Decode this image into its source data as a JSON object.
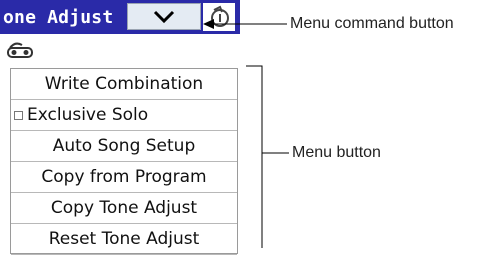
{
  "header": {
    "title": "one Adjust",
    "menu_command_icon": "chevron-down-icon",
    "edge_icon": "rotate-icon"
  },
  "sub_icon": "connector-icon",
  "menu": {
    "items": [
      {
        "label": "Write Combination",
        "checkbox": false
      },
      {
        "label": "Exclusive Solo",
        "checkbox": true
      },
      {
        "label": "Auto Song Setup",
        "checkbox": false
      },
      {
        "label": "Copy from Program",
        "checkbox": false
      },
      {
        "label": "Copy Tone Adjust",
        "checkbox": false
      },
      {
        "label": "Reset Tone Adjust",
        "checkbox": false
      }
    ]
  },
  "annotations": {
    "menu_command_button": "Menu command button",
    "menu_button": "Menu button"
  },
  "colors": {
    "header_bg": "#2a2aa8",
    "button_bg": "#e4ebf3",
    "text": "#111111"
  }
}
